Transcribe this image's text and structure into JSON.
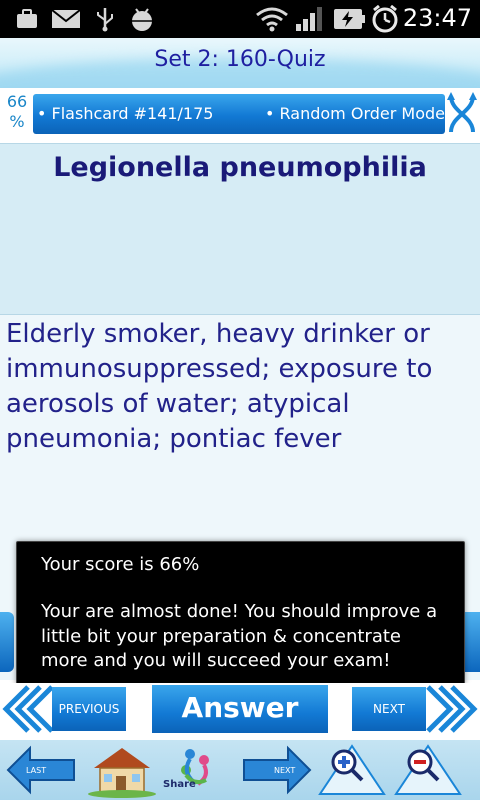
{
  "status_bar": {
    "time": "23:47",
    "icons": [
      "briefcase-icon",
      "mail-icon",
      "usb-icon",
      "android-debug-icon",
      "wifi-icon",
      "signal-icon",
      "battery-charging-icon",
      "alarm-icon"
    ]
  },
  "title": "Set 2: 160-Quiz",
  "progress": {
    "percent_line1": "66",
    "percent_line2": "%",
    "flashcard_label": "• Flashcard #141/175",
    "mode_label": "• Random Order Mode"
  },
  "question": "Legionella pneumophilia",
  "answer": "Elderly smoker, heavy drinker or immunosuppressed; exposure to aerosols of water; atypical pneumonia; pontiac fever",
  "toast": {
    "score": "Your score is 66%",
    "message": "Your are almost done! You should improve a little bit your preparation & concentrate more and you will succeed your exam!"
  },
  "nav": {
    "previous": "PREVIOUS",
    "answer": "Answer",
    "next": "NEXT"
  },
  "toolbar": {
    "last": "LAST",
    "share": "Share",
    "next": "NEXT"
  },
  "colors": {
    "title_text": "#1f1fa0",
    "accent_blue": "#1279d4",
    "question_bg": "#d6ecf5",
    "answer_text": "#22228a"
  }
}
